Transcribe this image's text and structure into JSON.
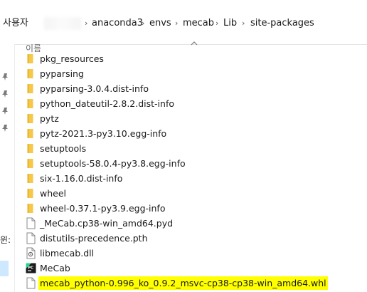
{
  "breadcrumb": {
    "items": [
      "사용자",
      "anaconda3",
      "envs",
      "mecab",
      "Lib",
      "site-packages"
    ],
    "separator": "›"
  },
  "nav": {
    "partial_label": "윈:"
  },
  "list": {
    "column_name": "이름",
    "files": [
      {
        "name": "pkg_resources",
        "type": "folder"
      },
      {
        "name": "pyparsing",
        "type": "folder"
      },
      {
        "name": "pyparsing-3.0.4.dist-info",
        "type": "folder"
      },
      {
        "name": "python_dateutil-2.8.2.dist-info",
        "type": "folder"
      },
      {
        "name": "pytz",
        "type": "folder"
      },
      {
        "name": "pytz-2021.3-py3.10.egg-info",
        "type": "folder"
      },
      {
        "name": "setuptools",
        "type": "folder"
      },
      {
        "name": "setuptools-58.0.4-py3.8.egg-info",
        "type": "folder"
      },
      {
        "name": "six-1.16.0.dist-info",
        "type": "folder"
      },
      {
        "name": "wheel",
        "type": "folder"
      },
      {
        "name": "wheel-0.37.1-py3.9.egg-info",
        "type": "folder"
      },
      {
        "name": "_MeCab.cp38-win_amd64.pyd",
        "type": "file"
      },
      {
        "name": "distutils-precedence.pth",
        "type": "file"
      },
      {
        "name": "libmecab.dll",
        "type": "dll"
      },
      {
        "name": "MeCab",
        "type": "pycharm"
      },
      {
        "name": "mecab_python-0.996_ko_0.9.2_msvc-cp38-cp38-win_amd64.whl",
        "type": "file",
        "highlighted": true
      }
    ]
  },
  "colors": {
    "folder": "#e8b32a",
    "highlight": "#ffff00",
    "selection": "#cde8ff"
  }
}
